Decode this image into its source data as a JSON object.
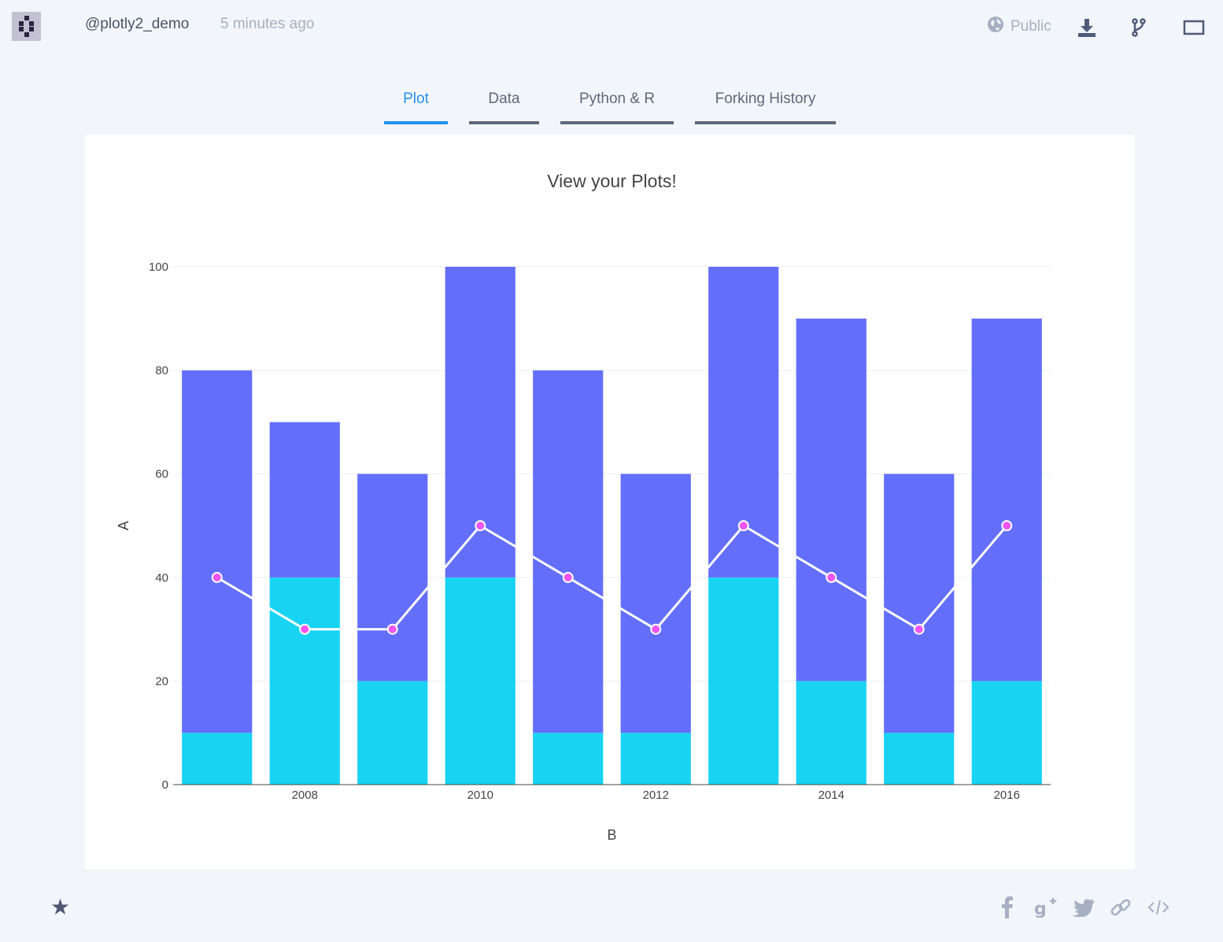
{
  "header": {
    "username": "@plotly2_demo",
    "timestamp": "5 minutes ago",
    "visibility": "Public",
    "icons": [
      "globe-icon",
      "download-icon",
      "fork-icon",
      "fullscreen-icon"
    ]
  },
  "tabs": [
    {
      "label": "Plot",
      "active": true
    },
    {
      "label": "Data",
      "active": false
    },
    {
      "label": "Python & R",
      "active": false
    },
    {
      "label": "Forking History",
      "active": false
    }
  ],
  "footer": {
    "icons": [
      "star-icon",
      "facebook-icon",
      "google-plus-icon",
      "twitter-icon",
      "link-icon",
      "embed-icon"
    ]
  },
  "colors": {
    "accent": "#2391eb",
    "bar_top": "#636efa",
    "bar_bottom": "#19d3f3",
    "line": "#ffffff",
    "marker": "#ef55f1"
  },
  "chart_data": {
    "type": "bar",
    "title": "View your Plots!",
    "xlabel": "B",
    "ylabel": "A",
    "x": [
      2007,
      2008,
      2009,
      2010,
      2011,
      2012,
      2013,
      2014,
      2015,
      2016
    ],
    "xticks": [
      "2008",
      "2010",
      "2012",
      "2014",
      "2016"
    ],
    "ylim": [
      0,
      100
    ],
    "yticks": [
      "0",
      "20",
      "40",
      "60",
      "80",
      "100"
    ],
    "barmode": "stack",
    "grid": true,
    "series": [
      {
        "type": "bar",
        "values": [
          10,
          40,
          20,
          40,
          10,
          10,
          40,
          20,
          10,
          20
        ]
      },
      {
        "type": "bar",
        "values": [
          70,
          30,
          40,
          60,
          70,
          50,
          60,
          70,
          50,
          70
        ]
      },
      {
        "type": "line",
        "values": [
          40,
          30,
          30,
          50,
          40,
          30,
          50,
          40,
          30,
          50
        ]
      }
    ]
  }
}
